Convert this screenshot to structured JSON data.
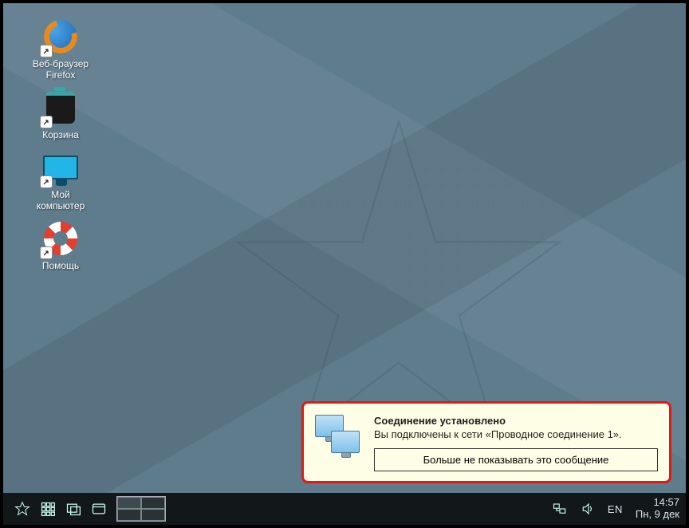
{
  "desktop_icons": [
    {
      "name": "firefox",
      "label": "Веб-браузер\nFirefox"
    },
    {
      "name": "trash",
      "label": "Корзина"
    },
    {
      "name": "computer",
      "label": "Мой\nкомпьютер"
    },
    {
      "name": "help",
      "label": "Помощь"
    }
  ],
  "notification": {
    "title": "Соединение установлено",
    "message": "Вы подключены к сети «Проводное соединение 1».",
    "button": "Больше не показывать это сообщение"
  },
  "taskbar": {
    "lang": "EN",
    "time": "14:57",
    "date": "Пн, 9 дек"
  }
}
